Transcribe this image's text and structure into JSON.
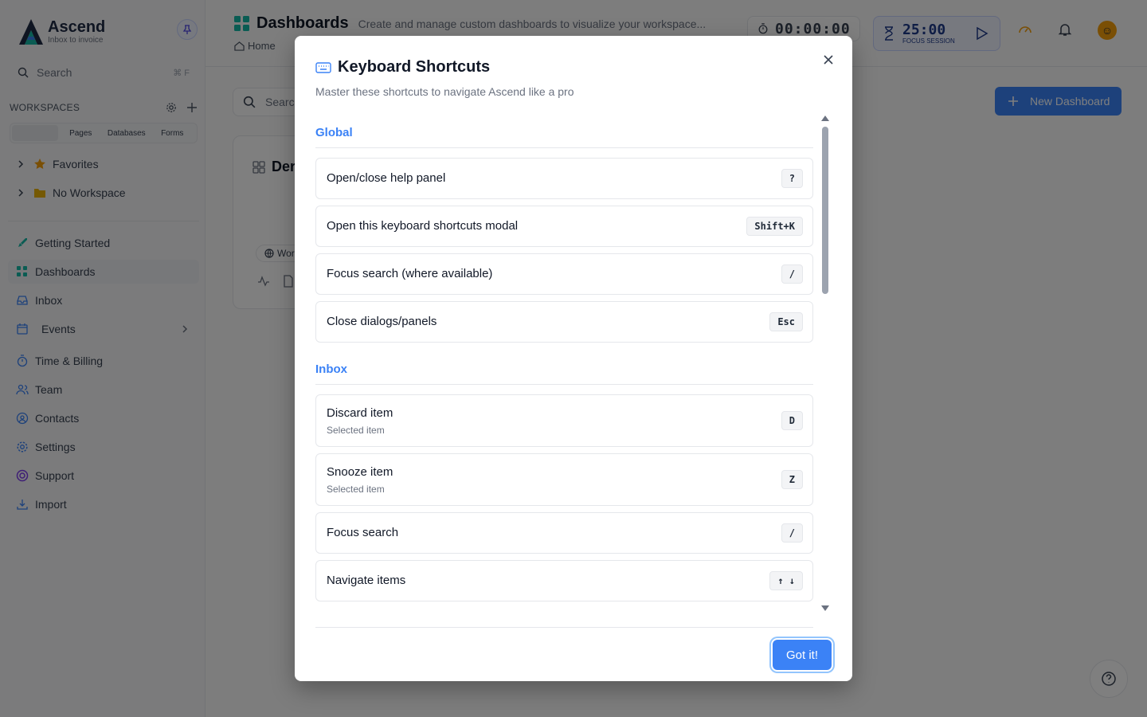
{
  "brand": {
    "name": "Ascend",
    "tagline": "Inbox to invoice"
  },
  "sidebar": {
    "search_label": "Search",
    "search_shortcut": "⌘ F",
    "workspaces_label": "WORKSPACES",
    "tabs": [
      "",
      "Pages",
      "Databases",
      "Forms"
    ],
    "tree": [
      {
        "label": "Favorites",
        "icon": "star-icon"
      },
      {
        "label": "No Workspace",
        "icon": "folder-icon"
      }
    ],
    "nav": [
      {
        "label": "Getting Started",
        "icon": "rocket-icon"
      },
      {
        "label": "Dashboards",
        "icon": "grid-icon"
      },
      {
        "label": "Inbox",
        "icon": "inbox-icon"
      },
      {
        "label": "Events",
        "icon": "calendar-icon"
      },
      {
        "label": "Time & Billing",
        "icon": "stopwatch-icon"
      },
      {
        "label": "Team",
        "icon": "users-icon"
      },
      {
        "label": "Contacts",
        "icon": "contact-icon"
      },
      {
        "label": "Settings",
        "icon": "gear-icon"
      },
      {
        "label": "Support",
        "icon": "lifebuoy-icon"
      },
      {
        "label": "Import",
        "icon": "download-icon"
      }
    ]
  },
  "header": {
    "title": "Dashboards",
    "description": "Create and manage custom dashboards to visualize your workspace...",
    "breadcrumb_home": "Home",
    "timer": "00:00:00",
    "focus_time": "25:00",
    "focus_label": "FOCUS SESSION"
  },
  "main": {
    "search_placeholder": "Searc",
    "new_button": "New Dashboard",
    "card_title": "Der",
    "card_tag": "Work"
  },
  "modal": {
    "title": "Keyboard Shortcuts",
    "subtitle": "Master these shortcuts to navigate Ascend like a pro",
    "sections": [
      {
        "name": "Global",
        "items": [
          {
            "label": "Open/close help panel",
            "key": "?"
          },
          {
            "label": "Open this keyboard shortcuts modal",
            "key": "Shift+K"
          },
          {
            "label": "Focus search (where available)",
            "key": "/"
          },
          {
            "label": "Close dialogs/panels",
            "key": "Esc"
          }
        ]
      },
      {
        "name": "Inbox",
        "items": [
          {
            "label": "Discard item",
            "sub": "Selected item",
            "key": "D"
          },
          {
            "label": "Snooze item",
            "sub": "Selected item",
            "key": "Z"
          },
          {
            "label": "Focus search",
            "key": "/"
          },
          {
            "label": "Navigate items",
            "key": "↑ ↓"
          }
        ]
      }
    ],
    "confirm_button": "Got it!"
  },
  "colors": {
    "accent": "#3b82f6",
    "brand_dark": "#1f2a44"
  }
}
